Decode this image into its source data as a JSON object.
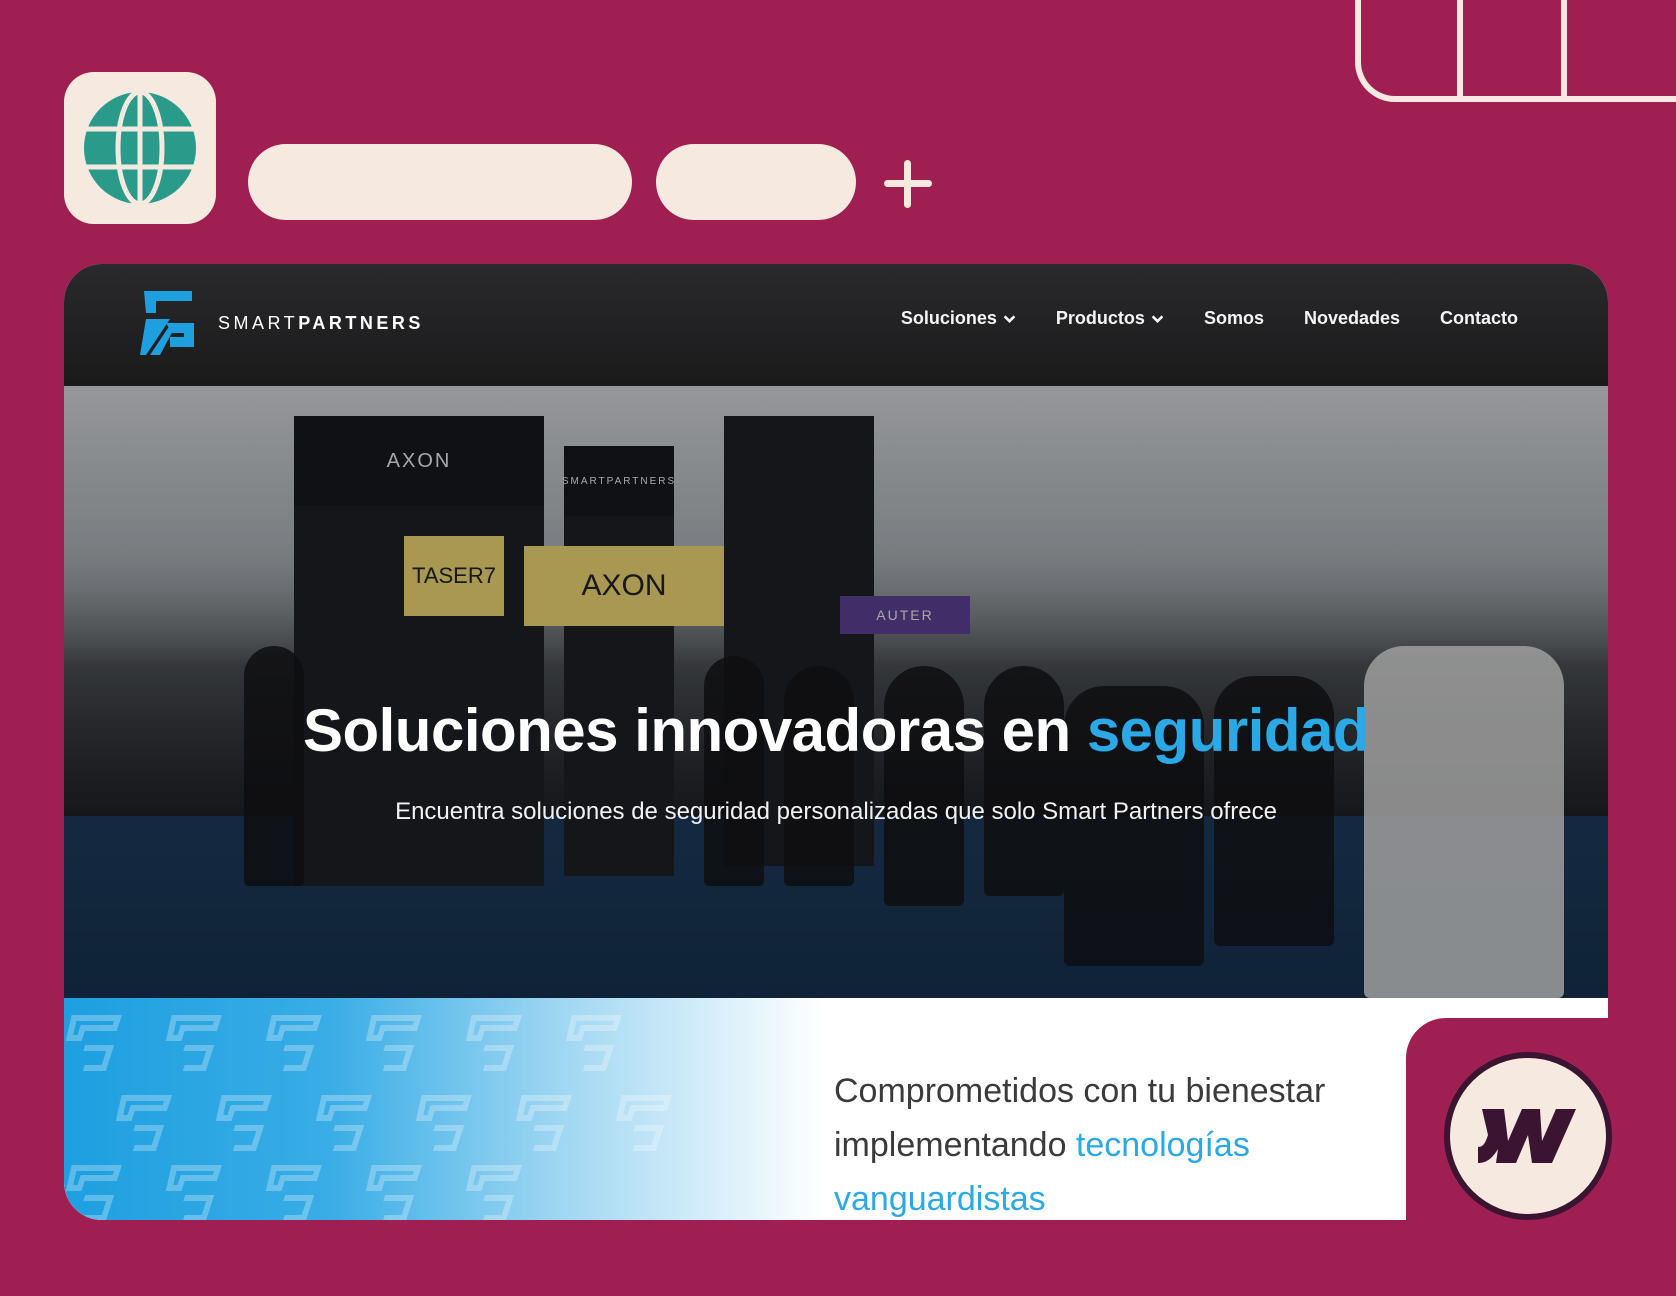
{
  "browser": {
    "new_tab_symbol": "+"
  },
  "site": {
    "logo_text_light": "SMART",
    "logo_text_bold": "PARTNERS",
    "nav": [
      {
        "label": "Soluciones",
        "has_dropdown": true
      },
      {
        "label": "Productos",
        "has_dropdown": true
      },
      {
        "label": "Somos",
        "has_dropdown": false
      },
      {
        "label": "Novedades",
        "has_dropdown": false
      },
      {
        "label": "Contacto",
        "has_dropdown": false
      }
    ],
    "hero": {
      "title_main": "Soluciones innovadoras en ",
      "title_accent": "seguridad",
      "subtitle": "Encuentra soluciones de seguridad personalizadas que solo Smart Partners ofrece",
      "booth_signs": [
        "AXON",
        "SMARTPARTNERS",
        "TASER7",
        "AXON",
        "AUTER"
      ]
    },
    "commitment": {
      "line1": "Comprometidos con tu bienestar",
      "line2_main": "implementando ",
      "line2_accent": "tecnologías",
      "line3_accent": "vanguardistas"
    }
  },
  "colors": {
    "frame": "#a01f52",
    "cream": "#f6e9e0",
    "accent_blue": "#2ba8e6",
    "globe": "#2a9a8a",
    "navbar": "#1f1f21"
  },
  "icons": {
    "globe": "globe-icon",
    "plus": "plus-icon",
    "webflow": "webflow-logo-icon",
    "chevron": "chevron-down-icon"
  }
}
